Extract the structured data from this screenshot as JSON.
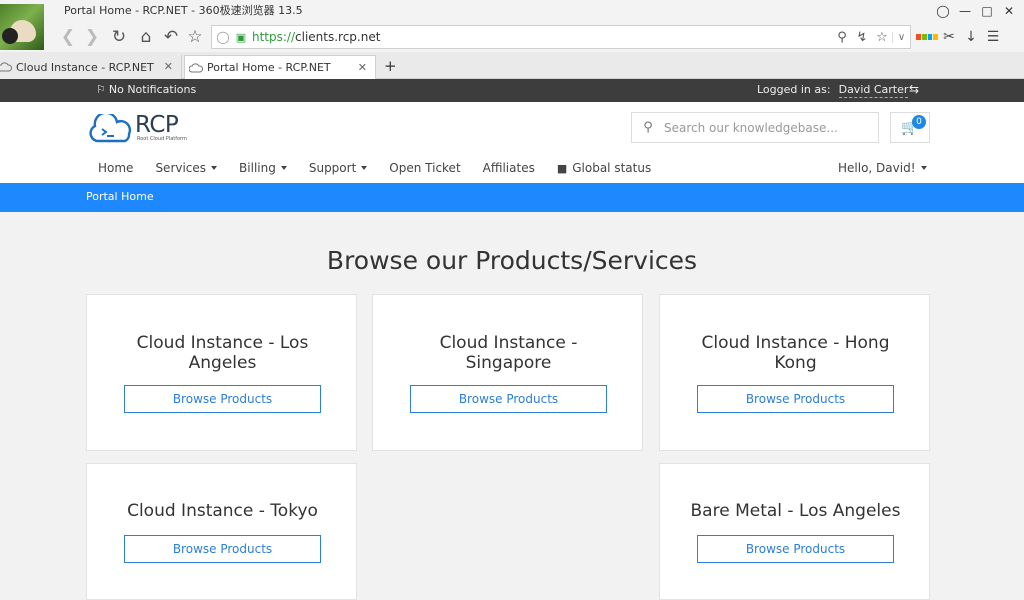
{
  "browser": {
    "window_title": "Portal Home - RCP.NET - 360极速浏览器 13.5",
    "url_scheme": "https://",
    "url_host": "clients.rcp.net",
    "tabs": [
      {
        "label": "Cloud Instance - RCP.NET"
      },
      {
        "label": "Portal Home - RCP.NET"
      }
    ],
    "newtab_label": "+"
  },
  "topbar": {
    "notifications": "No Notifications",
    "logged_in_label": "Logged in as:",
    "user_name": "David Carter"
  },
  "header": {
    "logo_text": "RCP",
    "logo_tagline": "Root Cloud Platform",
    "search_placeholder": "Search our knowledgebase...",
    "cart_count": "0"
  },
  "nav": {
    "items": [
      {
        "label": "Home"
      },
      {
        "label": "Services"
      },
      {
        "label": "Billing"
      },
      {
        "label": "Support"
      },
      {
        "label": "Open Ticket"
      },
      {
        "label": "Affiliates"
      },
      {
        "label": "Global status"
      }
    ],
    "greeting": "Hello, David!"
  },
  "breadcrumb": "Portal Home",
  "main": {
    "title": "Browse our Products/Services",
    "cards": [
      {
        "title": "Cloud Instance - Los Angeles",
        "button": "Browse Products"
      },
      {
        "title": "Cloud Instance - Singapore",
        "button": "Browse Products"
      },
      {
        "title": "Cloud Instance - Hong Kong",
        "button": "Browse Products"
      },
      {
        "title": "Cloud Instance - Tokyo",
        "button": "Browse Products"
      },
      {
        "title": "Bare Metal - Los Angeles",
        "button": "Browse Products"
      }
    ]
  },
  "colors": {
    "accent": "#1e88ff",
    "topbar": "#3d3d3d",
    "button_border": "#2b7fd6"
  }
}
